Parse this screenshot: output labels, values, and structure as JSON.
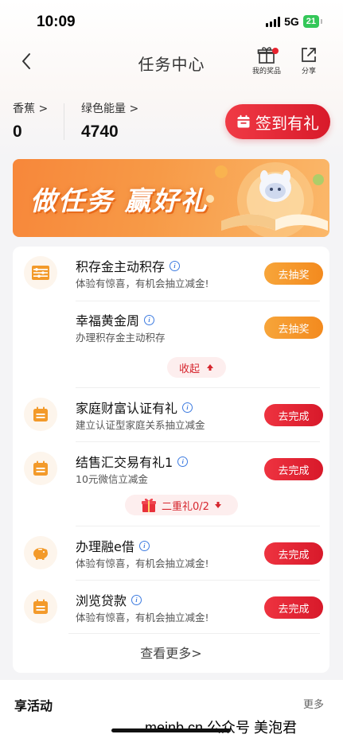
{
  "status": {
    "time": "10:09",
    "network": "5G",
    "battery": "21"
  },
  "nav": {
    "title": "任务中心",
    "my_prize": "我的奖品",
    "share": "分享"
  },
  "points": [
    {
      "label": "香蕉",
      "value": "0"
    },
    {
      "label": "绿色能量",
      "value": "4740"
    }
  ],
  "checkin_label": "签到有礼",
  "banner_title": "做任务 赢好礼",
  "tasks": [
    {
      "title": "积存金主动积存",
      "desc": "体验有惊喜，有机会抽立减金!",
      "button": "去抽奖",
      "icon": "abacus-icon"
    },
    {
      "title": "幸福黄金周",
      "desc": "办理积存金主动积存",
      "button": "去抽奖",
      "icon": ""
    },
    {
      "title": "家庭财富认证有礼",
      "desc": "建立认证型家庭关系抽立减金",
      "button": "去完成",
      "icon": "calendar-icon"
    },
    {
      "title": "结售汇交易有礼1",
      "desc": "10元微信立减金",
      "button": "去完成",
      "icon": "calendar-icon"
    },
    {
      "title": "办理融e借",
      "desc": "体验有惊喜，有机会抽立减金!",
      "button": "去完成",
      "icon": "piggy-bank-icon"
    },
    {
      "title": "浏览贷款",
      "desc": "体验有惊喜，有机会抽立减金!",
      "button": "去完成",
      "icon": "calendar-icon"
    }
  ],
  "collapse_label": "收起",
  "bonus_label": "二重礼0/2",
  "see_more": "查看更多>",
  "section": {
    "title": "享活动",
    "more": "更多"
  },
  "watermark": "meinb.cn 公众号 美泡君",
  "colors": {
    "primary_red": "#d8192a",
    "orange": "#f38a1e",
    "info_blue": "#3d7be0"
  }
}
